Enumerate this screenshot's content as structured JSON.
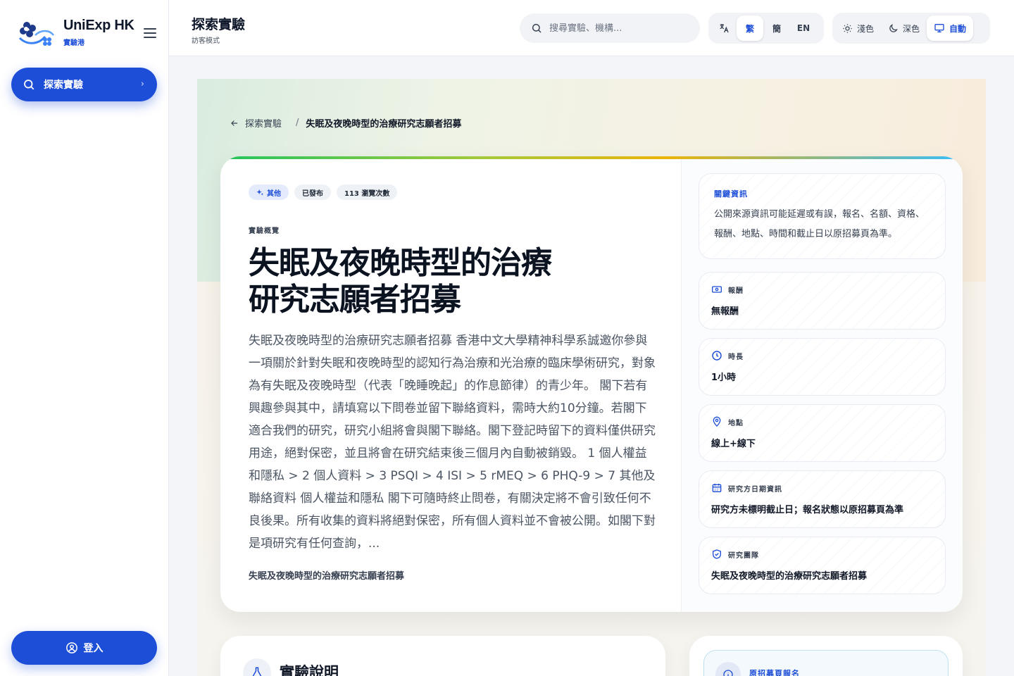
{
  "brand": {
    "name": "UniExp HK",
    "sub": "實驗港"
  },
  "sidebar": {
    "explore_label": "探索實驗",
    "login_label": "登入"
  },
  "header": {
    "title": "探索實驗",
    "mode": "訪客模式",
    "search_placeholder": "搜尋實驗、機構...",
    "languages": [
      "繁",
      "簡",
      "EN"
    ],
    "active_language": "繁",
    "themes": {
      "light": "淺色",
      "dark": "深色",
      "auto": "自動"
    },
    "active_theme": "自動"
  },
  "breadcrumb": {
    "parent": "探索實驗",
    "separator": "/",
    "current": "失眠及夜晚時型的治療研究志願者招募"
  },
  "study": {
    "tags": {
      "category": "其他",
      "status": "已發布",
      "views": "113 瀏覽次數"
    },
    "overview_label": "實驗概覽",
    "title": "失眠及夜晚時型的治療研究志願者招募",
    "description": "失眠及夜晚時型的治療研究志願者招募 香港中文大學精神科學系誠邀你參與一項關於針對失眠和夜晚時型的認知行為治療和光治療的臨床學術研究，對象為有失眠及夜晚時型（代表「晚睡晚起」的作息節律）的青少年。 閣下若有興趣參與其中，請填寫以下問卷並留下聯絡資料，需時大約10分鐘。若閣下適合我們的研究，研究小組將會與閣下聯絡。閣下登記時留下的資料僅供研究用途，絕對保密，並且將會在研究結束後三個月內自動被銷毀。 1 個人權益和隱私 > 2 個人資料 > 3 PSQI > 4 ISI > 5 rMEQ > 6 PHQ-9 > 7 其他及聯絡資料 個人權益和隱私 閣下可隨時終止問卷，有關決定將不會引致任何不良後果。所有收集的資料將絕對保密，所有個人資料並不會被公開。如閣下對是項研究有任何查詢，...",
    "org": "失眠及夜晚時型的治療研究志願者招募"
  },
  "key_info": {
    "title": "關鍵資訊",
    "body": "公開來源資訊可能延遲或有誤，報名、名額、資格、報酬、地點、時間和截止日以原招募頁為準。"
  },
  "fields": [
    {
      "label": "報酬",
      "value": "無報酬",
      "icon": "money-icon"
    },
    {
      "label": "時長",
      "value": "1小時",
      "icon": "clock-icon"
    },
    {
      "label": "地點",
      "value": "線上+線下",
      "icon": "location-pin-icon"
    },
    {
      "label": "研究方日期資訊",
      "value": "研究方未標明截止日；報名狀態以原招募頁為準",
      "icon": "calendar-icon"
    },
    {
      "label": "研究團隊",
      "value": "失眠及夜晚時型的治療研究志願者招募",
      "icon": "shield-icon"
    }
  ],
  "sections": {
    "experiment_description": "實驗說明",
    "original_recruit": "原招募頁報名"
  },
  "colors": {
    "accent": "#1d4ed8",
    "background": "#f3f5f9"
  }
}
